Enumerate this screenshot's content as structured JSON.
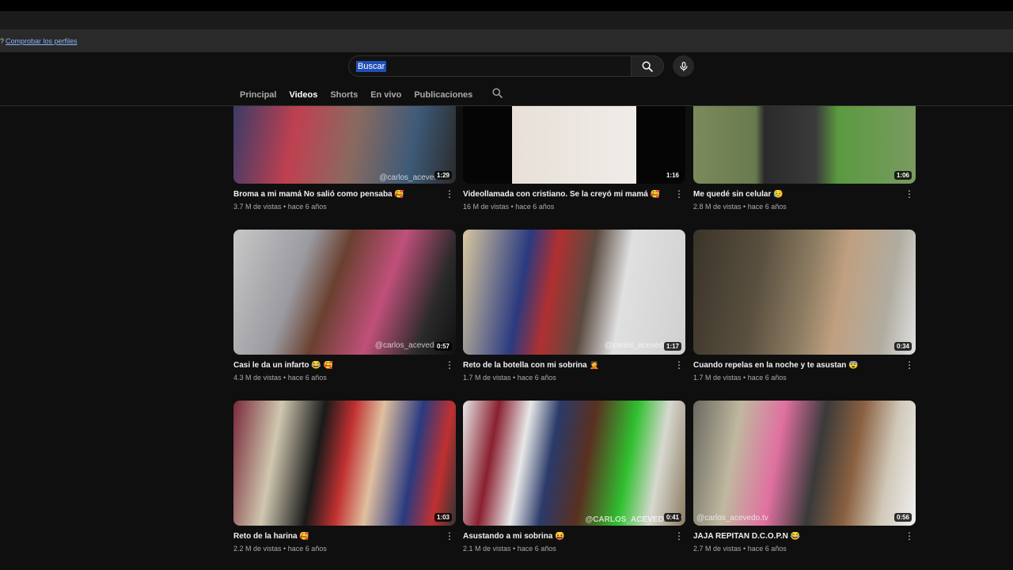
{
  "infobar": {
    "prefix": "?",
    "link": "Comprobar los perfiles"
  },
  "search": {
    "query": "Buscar"
  },
  "tabs": [
    "Principal",
    "Videos",
    "Shorts",
    "En vivo",
    "Publicaciones"
  ],
  "videos": [
    {
      "title": "Broma a mi mamá  No salió como pensaba 🥰",
      "views": "3.7 M de vistas",
      "age": "hace 6 años",
      "duration": "1:29",
      "watermark": "@carlos_acevedo.tv"
    },
    {
      "title": "Videollamada con cristiano. Se la creyó mi mamá 🥰",
      "views": "16 M de vistas",
      "age": "hace 6 años",
      "duration": "1:16",
      "watermark": ""
    },
    {
      "title": "Me quedé sin celular 😥",
      "views": "2.8 M de vistas",
      "age": "hace 6 años",
      "duration": "1:06",
      "watermark": ""
    },
    {
      "title": "Casi le da un infarto 😂 🥰",
      "views": "4.3 M de vistas",
      "age": "hace 6 años",
      "duration": "0:57",
      "watermark": "@carlos_acevedo"
    },
    {
      "title": "Reto de la botella con mi sobrina 🤦",
      "views": "1.7 M de vistas",
      "age": "hace 6 años",
      "duration": "1:17",
      "watermark": "@carlos_acevedo"
    },
    {
      "title": "Cuando repelas en la noche y te asustan 😨",
      "views": "1.7 M de vistas",
      "age": "hace 6 años",
      "duration": "0:34",
      "watermark": ""
    },
    {
      "title": "Reto de la harina 🥰",
      "views": "2.2 M de vistas",
      "age": "hace 6 años",
      "duration": "1:03",
      "watermark": ""
    },
    {
      "title": "Asustando a mi sobrina 😝",
      "views": "2.1 M de vistas",
      "age": "hace 6 años",
      "duration": "0:41",
      "watermark": "@CARLOS_ACEVEDO.TV"
    },
    {
      "title": "JAJA REPITAN D.C.O.P.N 😂",
      "views": "2.7 M de vistas",
      "age": "hace 6 años",
      "duration": "0:56",
      "watermark": "@carlos_acevedo.tv"
    }
  ],
  "colors": {
    "accent_selection": "#1f4fb8",
    "background": "#0f0f0f"
  }
}
